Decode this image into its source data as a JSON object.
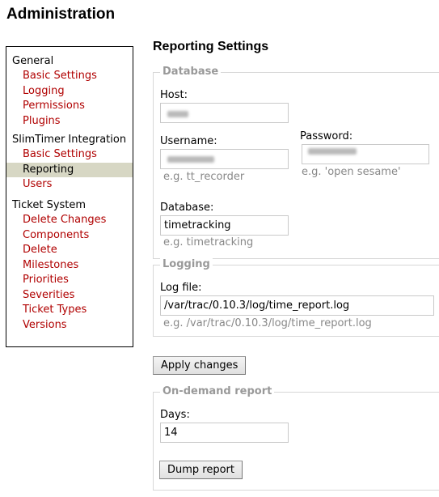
{
  "page_title": "Administration",
  "nav": {
    "groups": [
      {
        "title": "General",
        "items": [
          "Basic Settings",
          "Logging",
          "Permissions",
          "Plugins"
        ]
      },
      {
        "title": "SlimTimer Integration",
        "items": [
          "Basic Settings",
          "Reporting",
          "Users"
        ]
      },
      {
        "title": "Ticket System",
        "items": [
          "Delete Changes",
          "Components",
          "Delete",
          "Milestones",
          "Priorities",
          "Severities",
          "Ticket Types",
          "Versions"
        ]
      }
    ],
    "active_item": "Reporting"
  },
  "section_title": "Reporting Settings",
  "database": {
    "legend": "Database",
    "host_label": "Host:",
    "host_value": "",
    "username_label": "Username:",
    "username_value": "",
    "username_hint": "e.g. tt_recorder",
    "password_label": "Password:",
    "password_value": "",
    "password_hint": "e.g. 'open sesame'",
    "database_label": "Database:",
    "database_value": "timetracking",
    "database_hint": "e.g. timetracking"
  },
  "logging": {
    "legend": "Logging",
    "logfile_label": "Log file:",
    "logfile_value": "/var/trac/0.10.3/log/time_report.log",
    "logfile_hint": "e.g. /var/trac/0.10.3/log/time_report.log"
  },
  "apply_button": "Apply changes",
  "on_demand": {
    "legend": "On-demand report",
    "days_label": "Days:",
    "days_value": "14",
    "dump_button": "Dump report"
  },
  "colors": {
    "link": "#b00000",
    "active_bg": "#d7d7c4",
    "legend": "#999999"
  }
}
